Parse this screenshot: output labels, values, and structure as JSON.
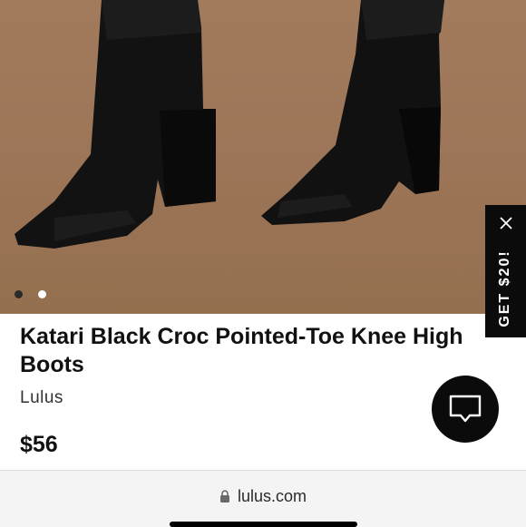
{
  "product": {
    "title": "Katari Black Croc Pointed-Toe Knee High Boots",
    "brand": "Lulus",
    "price": "$56"
  },
  "gallery": {
    "image_subject": "black croc boots image",
    "dots": [
      {
        "active": true
      },
      {
        "active": false
      }
    ]
  },
  "promo": {
    "label": "GET $20!",
    "close_icon": "close-icon"
  },
  "chat": {
    "icon": "chat-bubble-icon"
  },
  "browser": {
    "url": "lulus.com",
    "lock_icon": "lock-icon"
  },
  "colors": {
    "background": "#ffffff",
    "hero": "#9c7457",
    "promo": "#0b0b0b",
    "chat": "#0b0b0b",
    "text": "#111111",
    "urlbar": "#f4f4f4"
  }
}
